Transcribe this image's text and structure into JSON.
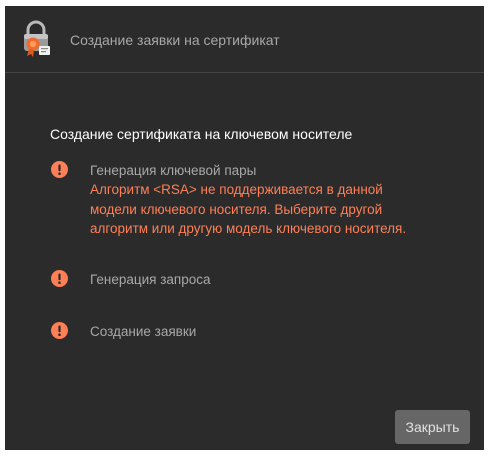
{
  "window": {
    "title": "Создание заявки на сертификат",
    "icon": "lock-certificate-icon"
  },
  "main": {
    "heading": "Создание сертификата на ключевом носителе",
    "steps": [
      {
        "label": "Генерация ключевой пары",
        "status": "error",
        "status_icon": "exclamation-circle-icon",
        "error_lines": [
          "Алгоритм <RSA> не поддерживается в данной",
          "модели ключевого носителя. Выберите другой",
          "алгоритм или другую модель ключевого носителя."
        ]
      },
      {
        "label": "Генерация запроса",
        "status": "error",
        "status_icon": "exclamation-circle-icon"
      },
      {
        "label": "Создание заявки",
        "status": "error",
        "status_icon": "exclamation-circle-icon"
      }
    ]
  },
  "footer": {
    "close_label": "Закрыть"
  },
  "colors": {
    "background": "#2b2b2b",
    "error": "#ff7f56",
    "muted_text": "#a8a8a8",
    "heading_text": "#ffffff",
    "button_bg": "#666666"
  }
}
